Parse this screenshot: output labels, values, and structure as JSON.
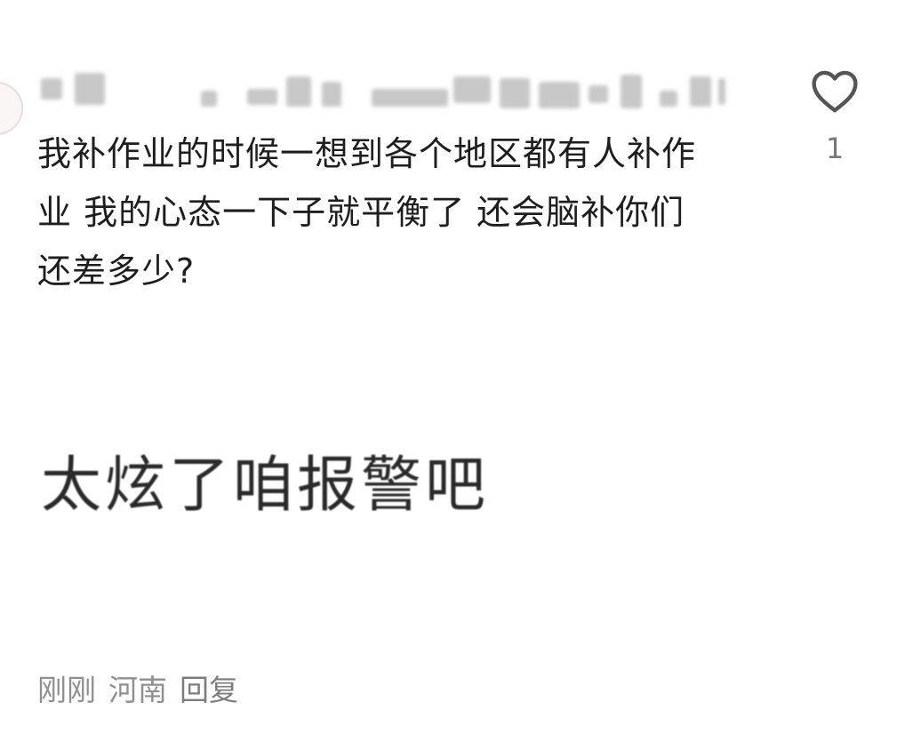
{
  "comment": {
    "text": "我补作业的时候一想到各个地区都有人补作\n业 我的心态一下子就平衡了 还会脑补你们\n还差多少?",
    "sticker_text": "太炫了咱报警吧",
    "meta": {
      "time": "刚刚",
      "location": "河南",
      "reply_label": "回复"
    },
    "like": {
      "icon": "heart-outline-icon",
      "count": "1"
    },
    "username_state": "blurred"
  }
}
